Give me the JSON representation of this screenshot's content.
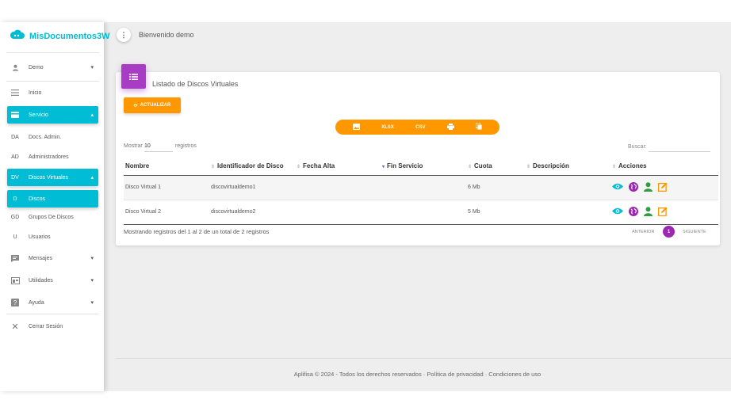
{
  "app": {
    "name": "MisDocumentos3W"
  },
  "header": {
    "welcome": "Bienvenido demo",
    "menu_glyph": "⋮"
  },
  "sidebar": {
    "user": "Demo",
    "items": [
      {
        "label": "Inicio",
        "icon": "menu-icon"
      },
      {
        "label": "Servicio",
        "icon": "card-icon"
      },
      {
        "label": "Docs. Admin.",
        "abbr": "DA"
      },
      {
        "label": "Administradores",
        "abbr": "AD"
      },
      {
        "label": "Discos Virtuales",
        "abbr": "DV"
      },
      {
        "label": "Discos",
        "abbr": "D"
      },
      {
        "label": "Grupos De Discos",
        "abbr": "GD"
      },
      {
        "label": "Usuarios",
        "abbr": "U"
      },
      {
        "label": "Mensajes",
        "icon": "chat-icon"
      },
      {
        "label": "Utilidades",
        "icon": "window-icon"
      },
      {
        "label": "Ayuda",
        "icon": "help-icon"
      },
      {
        "label": "Cerrar Sesión",
        "icon": "close-icon"
      }
    ]
  },
  "card": {
    "title": "Listado de Discos Virtuales",
    "refresh_label": "ACTUALIZAR",
    "export": {
      "xlsx": "XLSX",
      "csv": "CSV"
    },
    "show_prefix": "Mostrar",
    "show_value": "10",
    "show_suffix": "registros",
    "search_label": "Buscar:",
    "columns": [
      "Nombre",
      "Identificador de Disco",
      "Fecha Alta",
      "Fin Servicio",
      "Cuota",
      "Descripción",
      "Acciones"
    ],
    "rows": [
      {
        "nombre": "Disco Virtual 1",
        "id": "discovirtualdemo1",
        "fecha_alta": "",
        "fin_servicio": "",
        "cuota": "6 Mb",
        "descripcion": ""
      },
      {
        "nombre": "Disco Virtual 2",
        "id": "discovirtualdemo2",
        "fecha_alta": "",
        "fin_servicio": "",
        "cuota": "5 Mb",
        "descripcion": ""
      }
    ],
    "info": "Mostrando registros del 1 al 2 de un total de 2 registros",
    "pagination": {
      "prev": "ANTERIOR",
      "current": "1",
      "next": "SIGUIENTE"
    }
  },
  "footer": {
    "text": "Aplifisa © 2024 - Todos los derechos reservados · Política de privacidad · Condiciones de uso"
  },
  "colors": {
    "brand": "#00bcd4",
    "accent": "#ff9800",
    "purple": "#9c27b0",
    "green": "#2e9e44"
  }
}
